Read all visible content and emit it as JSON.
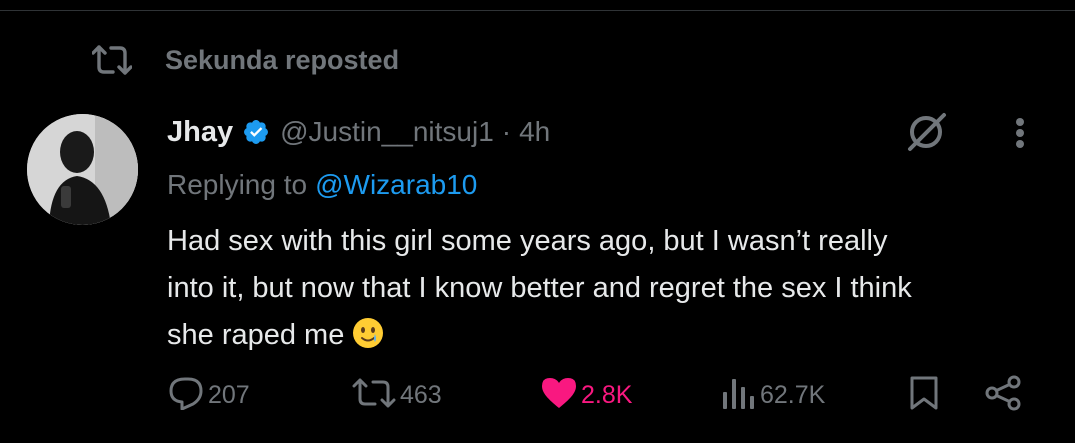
{
  "repost": {
    "icon": "repost-icon",
    "label": "Sekunda reposted"
  },
  "tweet": {
    "author_name": "Jhay",
    "verified_icon": "verified-badge-icon",
    "handle": "@Justin__nitsuj1",
    "separator": "·",
    "time": "4h",
    "replying_prefix": "Replying to",
    "replying_to": "@Wizarab10",
    "text_lines": [
      "Had sex with this girl some years ago, but I wasn’t really",
      "into it, but now that I know better and regret the sex I think",
      "she raped me"
    ],
    "emoji": "smiling-face-with-tear-emoji"
  },
  "actions": {
    "replies": "207",
    "reposts": "463",
    "likes": "2.8K",
    "views": "62.7K"
  },
  "colors": {
    "background": "#000000",
    "text": "#e7e9ea",
    "muted": "#71767b",
    "link": "#1d9bf0",
    "like": "#f91880",
    "verified": "#1d9bf0"
  }
}
